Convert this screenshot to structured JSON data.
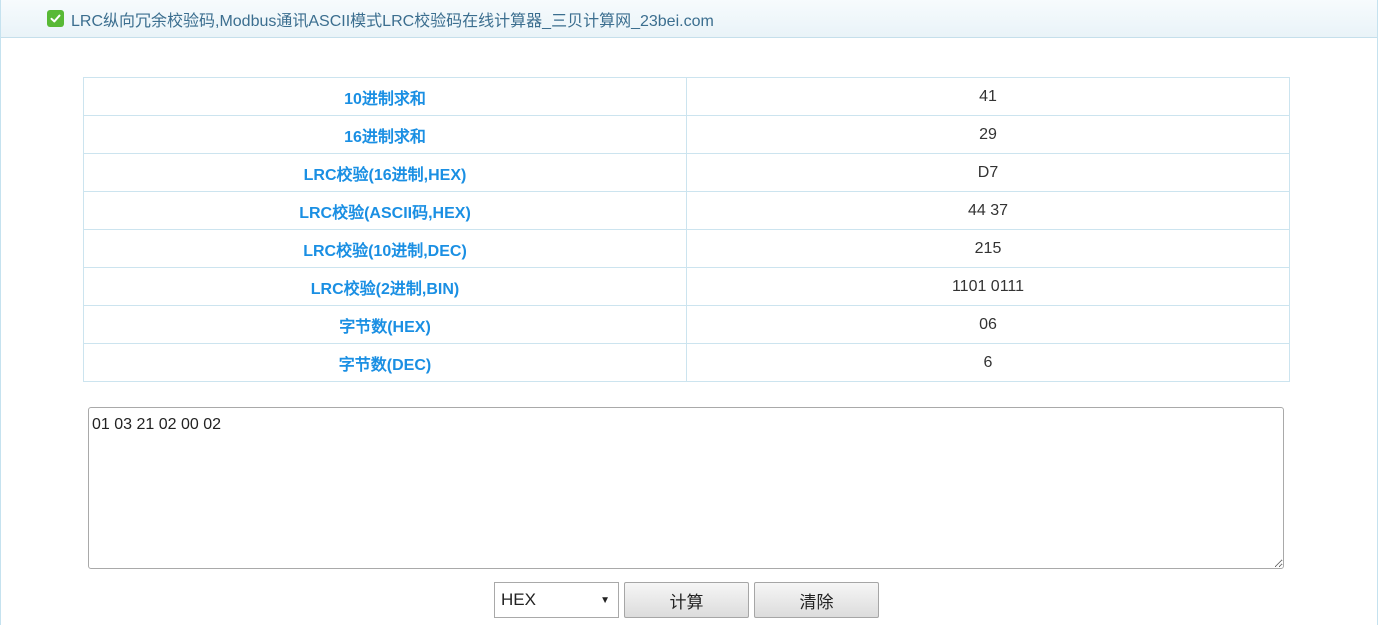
{
  "page": {
    "title": "LRC纵向冗余校验码,Modbus通讯ASCII模式LRC校验码在线计算器_三贝计算网_23bei.com"
  },
  "results": [
    {
      "label": "10进制求和",
      "value": "41"
    },
    {
      "label": "16进制求和",
      "value": "29"
    },
    {
      "label": "LRC校验(16进制,HEX)",
      "value": "D7"
    },
    {
      "label": "LRC校验(ASCII码,HEX)",
      "value": "44 37"
    },
    {
      "label": "LRC校验(10进制,DEC)",
      "value": "215"
    },
    {
      "label": "LRC校验(2进制,BIN)",
      "value": "1101 0111"
    },
    {
      "label": "字节数(HEX)",
      "value": "06"
    },
    {
      "label": "字节数(DEC)",
      "value": "6"
    }
  ],
  "input": {
    "value": "01 03 21 02 00 02"
  },
  "controls": {
    "format_selected": "HEX",
    "calculate_label": "计算",
    "clear_label": "清除"
  },
  "colors": {
    "label": "#1a8fe3",
    "check_icon": "#58b935",
    "title": "#3b6e8f"
  },
  "icons": {
    "title_icon": "check-icon",
    "select_icon": "dropdown-arrow-icon"
  }
}
